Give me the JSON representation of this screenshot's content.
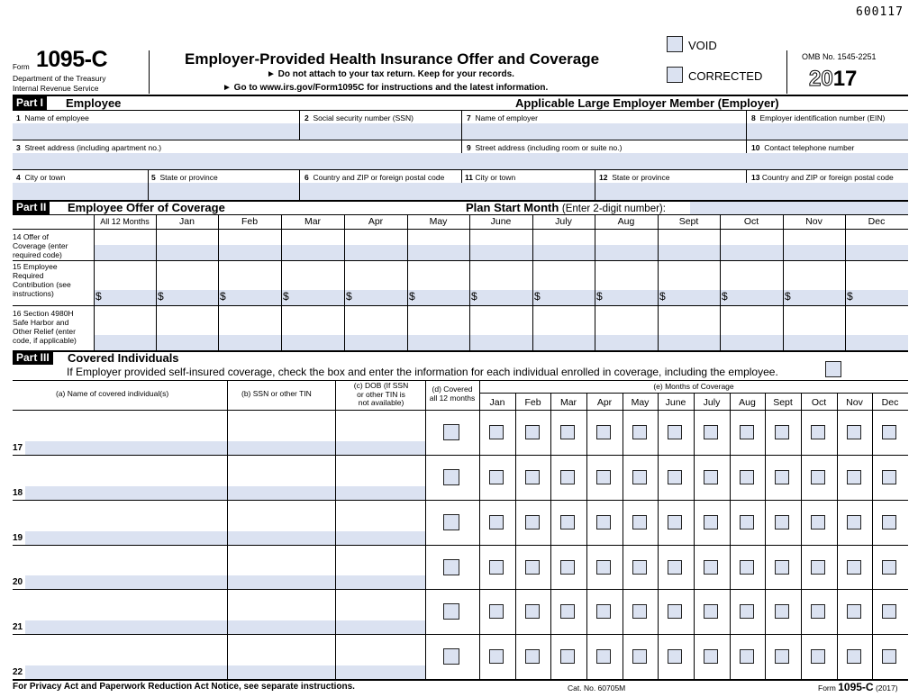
{
  "form_code": "600117",
  "header": {
    "form_word": "Form",
    "form_number": "1095-C",
    "dept_line1": "Department of the Treasury",
    "dept_line2": "Internal Revenue Service",
    "title": "Employer-Provided Health Insurance Offer and Coverage",
    "instruction1": "► Do not attach to your tax return. Keep for your records.",
    "instruction2": "► Go to www.irs.gov/Form1095C for instructions and the latest information.",
    "void_label": "VOID",
    "corrected_label": "CORRECTED",
    "omb": "OMB No. 1545-2251",
    "year_prefix": "20",
    "year_suffix": "17"
  },
  "part1": {
    "tag": "Part I",
    "title": "Employee",
    "employer_title": "Applicable Large Employer Member (Employer)",
    "fields": {
      "f1_num": "1",
      "f1": "Name of employee",
      "f2_num": "2",
      "f2": "Social security number (SSN)",
      "f3_num": "3",
      "f3": "Street address (including apartment no.)",
      "f4_num": "4",
      "f4": "City or town",
      "f5_num": "5",
      "f5": "State or province",
      "f6_num": "6",
      "f6": "Country and ZIP or foreign postal code",
      "f7_num": "7",
      "f7": "Name of employer",
      "f8_num": "8",
      "f8": "Employer identification number (EIN)",
      "f9_num": "9",
      "f9": "Street address (including room or suite no.)",
      "f10_num": "10",
      "f10": "Contact telephone number",
      "f11_num": "11",
      "f11": "City or town",
      "f12_num": "12",
      "f12": "State or province",
      "f13_num": "13",
      "f13": "Country and ZIP or foreign postal code"
    }
  },
  "part2": {
    "tag": "Part II",
    "title": "Employee Offer of Coverage",
    "plan_start_bold": "Plan Start Month",
    "plan_start_rest": "(Enter 2-digit number):",
    "months": [
      "All 12 Months",
      "Jan",
      "Feb",
      "Mar",
      "Apr",
      "May",
      "June",
      "July",
      "Aug",
      "Sept",
      "Oct",
      "Nov",
      "Dec"
    ],
    "row14": [
      "14 Offer of",
      "Coverage (enter",
      "required code)"
    ],
    "row15": [
      "15 Employee",
      "Required",
      "Contribution (see",
      "instructions)"
    ],
    "row16": [
      "16 Section 4980H",
      "Safe Harbor and",
      "Other Relief (enter",
      "code, if applicable)"
    ],
    "dollar": "$"
  },
  "part3": {
    "tag": "Part III",
    "title": "Covered Individuals",
    "instruction": "If Employer provided self-insured coverage, check the box and enter the information for each individual enrolled in coverage, including the employee.",
    "col_a": "(a) Name of covered individual(s)",
    "col_b": "(b) SSN or other TIN",
    "col_c": [
      "(c) DOB (If SSN",
      "or other TIN is",
      "not available)"
    ],
    "col_d": [
      "(d) Covered",
      "all 12 months"
    ],
    "col_e": "(e) Months of Coverage",
    "months": [
      "Jan",
      "Feb",
      "Mar",
      "Apr",
      "May",
      "June",
      "July",
      "Aug",
      "Sept",
      "Oct",
      "Nov",
      "Dec"
    ],
    "rows": [
      "17",
      "18",
      "19",
      "20",
      "21",
      "22"
    ]
  },
  "footer": {
    "privacy": "For Privacy Act and Paperwork Reduction Act Notice, see separate instructions.",
    "cat": "Cat. No. 60705M",
    "form_prefix": "Form",
    "form_number": "1095-C",
    "year": "(2017)"
  }
}
